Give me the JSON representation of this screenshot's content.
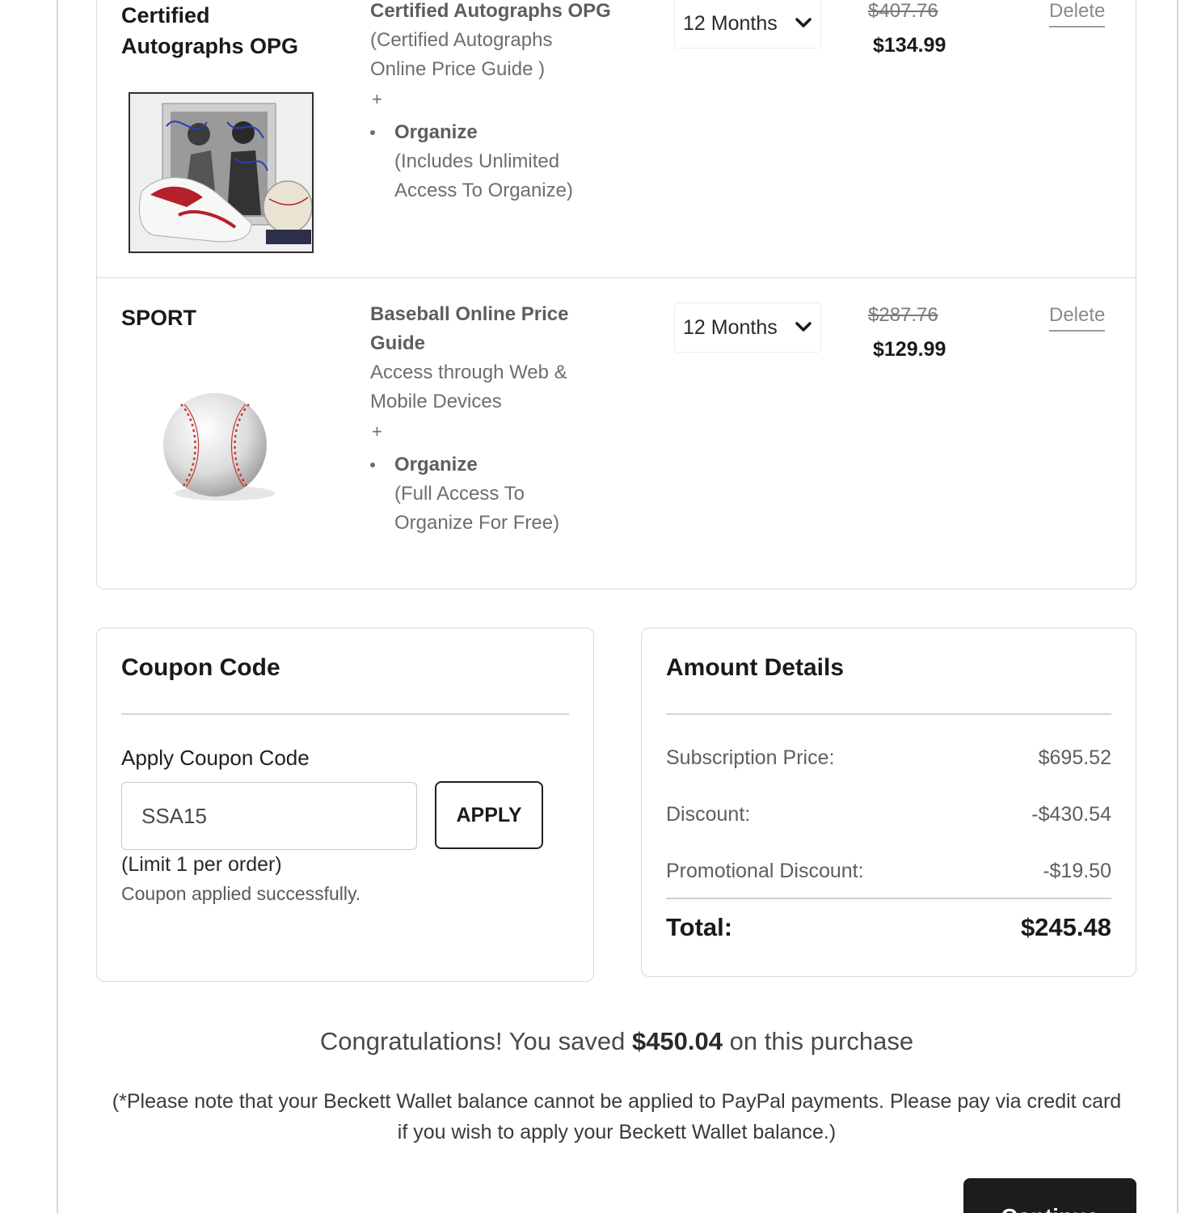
{
  "cart": {
    "items": [
      {
        "category": "Certified Autographs OPG",
        "product_name": "Certified Autographs OPG",
        "product_subtitle": "(Certified Autographs Online Price Guide )",
        "plus": "+",
        "feature_name": "Organize",
        "feature_desc": "(Includes Unlimited Access To Organize)",
        "term": "12 Months",
        "original_price": "$407.76",
        "price": "$134.99",
        "delete_label": "Delete",
        "image_icon": "autographs-memorabilia-image"
      },
      {
        "category": "SPORT",
        "product_name": "Baseball Online Price Guide",
        "product_subtitle": "Access through Web & Mobile Devices",
        "plus": "+",
        "feature_name": "Organize",
        "feature_desc": "(Full Access To Organize For Free)",
        "term": "12 Months",
        "original_price": "$287.76",
        "price": "$129.99",
        "delete_label": "Delete",
        "image_icon": "baseball-image"
      }
    ]
  },
  "coupon": {
    "title": "Coupon Code",
    "label": "Apply Coupon Code",
    "value": "SSA15",
    "apply_label": "APPLY",
    "limit_text": "(Limit 1 per order)",
    "status_text": "Coupon applied successfully."
  },
  "amount": {
    "title": "Amount Details",
    "rows": [
      {
        "label": "Subscription Price:",
        "value": "$695.52"
      },
      {
        "label": "Discount:",
        "value": "-$430.54"
      },
      {
        "label": "Promotional Discount:",
        "value": "-$19.50"
      }
    ],
    "total_label": "Total:",
    "total_value": "$245.48"
  },
  "savings": {
    "prefix": "Congratulations! You saved ",
    "amount": "$450.04",
    "suffix": " on this purchase"
  },
  "note": "(*Please note that your Beckett Wallet balance cannot be applied to PayPal payments. Please pay via credit card if you wish to apply your Beckett Wallet balance.)",
  "continue_label": "Continue"
}
